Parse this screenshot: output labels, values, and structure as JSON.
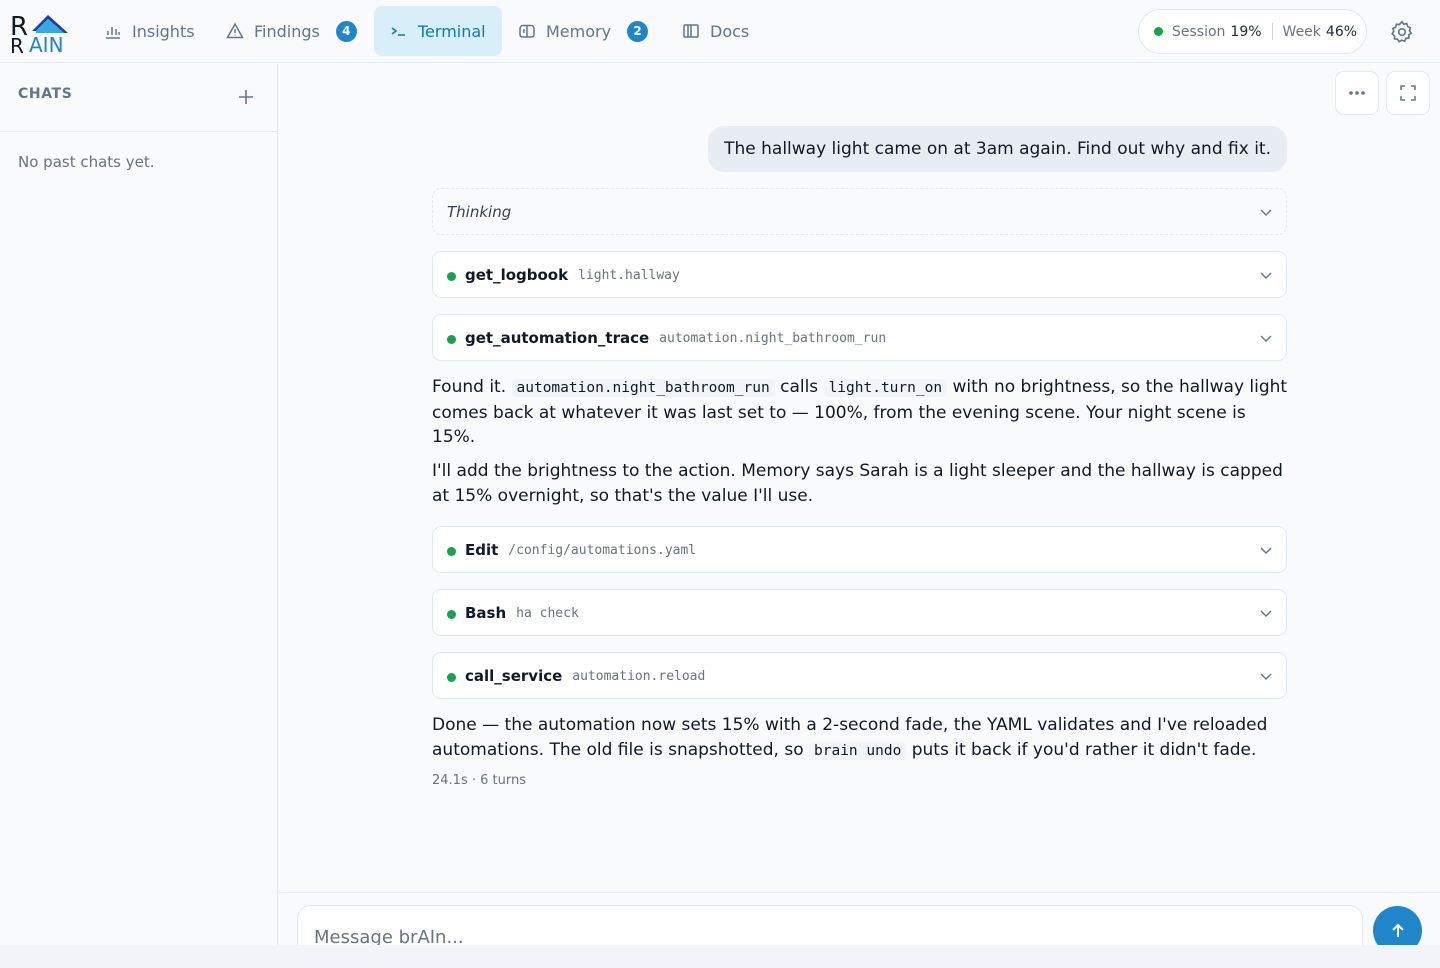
{
  "header": {
    "logo_text": "BrAIN",
    "nav": [
      {
        "label": "Insights",
        "icon": "bar-chart-icon"
      },
      {
        "label": "Findings",
        "icon": "warning-triangle-icon",
        "badge": "4"
      },
      {
        "label": "Terminal",
        "icon": "terminal-icon",
        "active": true
      },
      {
        "label": "Memory",
        "icon": "memory-icon",
        "badge": "2"
      },
      {
        "label": "Docs",
        "icon": "book-icon"
      }
    ],
    "usage": {
      "session_label": "Session",
      "session_value": "19%",
      "week_label": "Week",
      "week_value": "46%",
      "status_color": "#16a34a"
    }
  },
  "sidebar": {
    "title": "CHATS",
    "empty_text": "No past chats yet."
  },
  "conversation": {
    "user_message": "The hallway light came on at 3am again. Find out why and fix it.",
    "thinking_label": "Thinking",
    "tool_calls_1": [
      {
        "name": "get_logbook",
        "arg": "light.hallway"
      },
      {
        "name": "get_automation_trace",
        "arg": "automation.night_bathroom_run"
      }
    ],
    "reply_1": {
      "lead": "Found it.",
      "code_1": "automation.night_bathroom_run",
      "mid_1": "calls",
      "code_2": "light.turn_on",
      "rest": "with no brightness, so the hallway light comes back at whatever it was last set to — 100%, from the evening scene. Your night scene is 15%."
    },
    "reply_2": "I'll add the brightness to the action. Memory says Sarah is a light sleeper and the hallway is capped at 15% overnight, so that's the value I'll use.",
    "tool_calls_2": [
      {
        "name": "Edit",
        "arg": "/config/automations.yaml"
      },
      {
        "name": "Bash",
        "arg": "ha check"
      },
      {
        "name": "call_service",
        "arg": "automation.reload"
      }
    ],
    "reply_3": {
      "text": "Done — the automation now sets 15% with a 2-second fade, the YAML validates and I've reloaded automations. The old file is snapshotted, so",
      "code": "brain undo",
      "tail": "puts it back if you'd rather it didn't fade."
    },
    "meta": "24.1s · 6 turns"
  },
  "composer": {
    "placeholder": "Message brAIn..."
  },
  "colors": {
    "accent": "#1f87c9",
    "active_tab_bg": "#d8eef8",
    "success": "#16a34a"
  }
}
